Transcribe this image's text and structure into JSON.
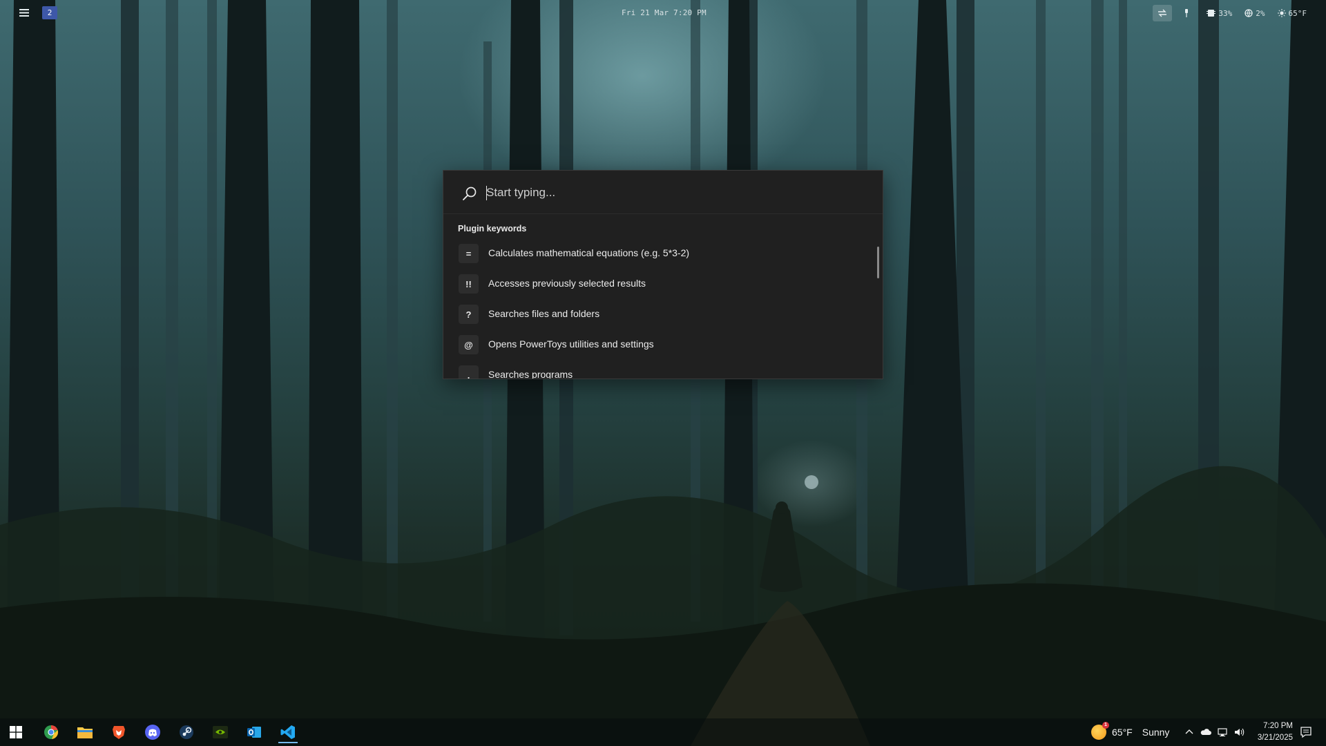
{
  "topbar": {
    "workspace_number": "2",
    "datetime": "Fri 21 Mar 7:20 PM",
    "cpu_percent": "33%",
    "network_percent": "2%",
    "temperature": "65°F",
    "icons": [
      "menu-icon",
      "sync-icon",
      "pin-icon",
      "cpu-icon",
      "globe-icon",
      "sun-icon"
    ]
  },
  "launcher": {
    "search": {
      "placeholder": "Start typing...",
      "value": ""
    },
    "section_title": "Plugin keywords",
    "results": [
      {
        "keyword": "=",
        "description": "Calculates mathematical equations (e.g. 5*3-2)"
      },
      {
        "keyword": "!!",
        "description": "Accesses previously selected results"
      },
      {
        "keyword": "?",
        "description": "Searches files and folders"
      },
      {
        "keyword": "@",
        "description": "Opens PowerToys utilities and settings"
      },
      {
        "keyword": ".",
        "description": "Searches programs"
      }
    ]
  },
  "taskbar": {
    "apps": [
      {
        "name": "start-button",
        "icon": "windows-logo-icon"
      },
      {
        "name": "chrome",
        "icon": "chrome-icon"
      },
      {
        "name": "file-explorer",
        "icon": "folder-icon"
      },
      {
        "name": "brave",
        "icon": "brave-lion-icon"
      },
      {
        "name": "discord",
        "icon": "discord-icon"
      },
      {
        "name": "steam",
        "icon": "steam-icon"
      },
      {
        "name": "nvidia",
        "icon": "nvidia-icon"
      },
      {
        "name": "outlook",
        "icon": "outlook-icon"
      },
      {
        "name": "vscode",
        "icon": "vscode-icon"
      }
    ],
    "weather": {
      "temperature": "65°F",
      "condition": "Sunny",
      "alert_count": "1"
    },
    "clock": {
      "time": "7:20 PM",
      "date": "3/21/2025"
    }
  },
  "colors": {
    "launcher_bg": "#202020",
    "workspace_badge": "#3e58a8",
    "taskbar_accent": "#76b9ed"
  }
}
